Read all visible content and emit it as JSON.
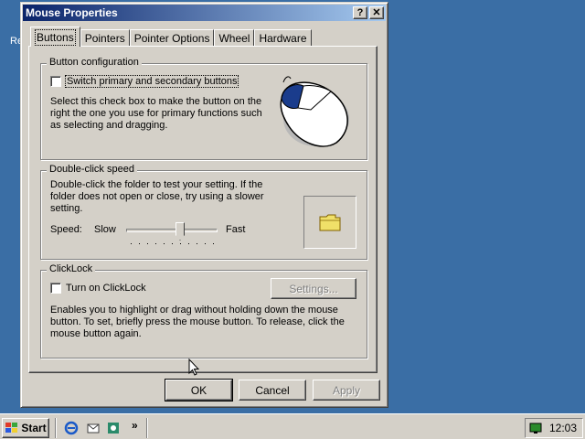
{
  "desktop": {
    "icon_label": "Re"
  },
  "window": {
    "title": "Mouse Properties",
    "help_button": "?",
    "close_button": "✕"
  },
  "tabs": [
    {
      "label": "Buttons",
      "active": true
    },
    {
      "label": "Pointers"
    },
    {
      "label": "Pointer Options"
    },
    {
      "label": "Wheel"
    },
    {
      "label": "Hardware"
    }
  ],
  "button_config": {
    "group_label": "Button configuration",
    "checkbox_label": "Switch primary and secondary buttons",
    "checked": false,
    "description": "Select this check box to make the button on the right the one you use for primary functions such as selecting and dragging."
  },
  "double_click": {
    "group_label": "Double-click speed",
    "description": "Double-click the folder to test your setting. If the folder does not open or close, try using a slower setting.",
    "speed_label": "Speed:",
    "slow_label": "Slow",
    "fast_label": "Fast",
    "slider_value": 0.6
  },
  "clicklock": {
    "group_label": "ClickLock",
    "checkbox_label": "Turn on ClickLock",
    "checked": false,
    "settings_button": "Settings...",
    "description": "Enables you to highlight or drag without holding down the mouse button. To set, briefly press the mouse button. To release, click the mouse button again."
  },
  "footer": {
    "ok": "OK",
    "cancel": "Cancel",
    "apply": "Apply"
  },
  "taskbar": {
    "start": "Start",
    "overflow": "»",
    "clock": "12:03"
  }
}
